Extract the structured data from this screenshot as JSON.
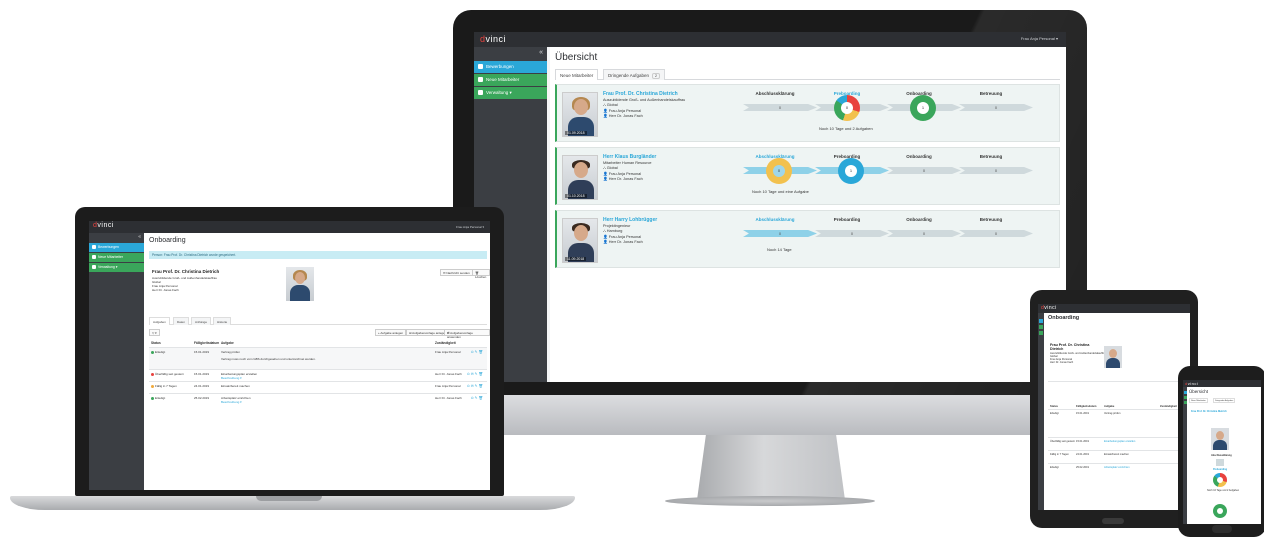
{
  "brand": {
    "prefix": "d",
    "name": "vinci"
  },
  "colors": {
    "accent": "#2aa7d8",
    "green": "#3aa65b",
    "dark": "#2d2f33",
    "red": "#e8423e"
  },
  "desktop": {
    "user": "Frau Anja Personal ▾",
    "collapse": "«",
    "nav": [
      {
        "label": "Bewerbungen",
        "icon": "user-icon"
      },
      {
        "label": "Neue Mitarbeiter",
        "icon": "eye-icon"
      },
      {
        "label": "Verwaltung ▾",
        "icon": "grid-icon"
      }
    ],
    "title": "Übersicht",
    "tabs": [
      {
        "label": "Neue Mitarbeiter"
      },
      {
        "label": "Dringende Aufgaben",
        "count": "2"
      }
    ],
    "phases": [
      "Abschlussklärung",
      "Preboarding",
      "Onboarding",
      "Betreuung"
    ],
    "cards": [
      {
        "name": "Frau Prof. Dr. Christina Dietrich",
        "role": "Auszubildende Groß- und Außenhandelskauffrau",
        "location": "Global",
        "contact1": "Frau Anja Personal",
        "contact2": "Herr Dr. Jonas Fach",
        "date": "01.09.2018",
        "values": [
          "0",
          "0",
          "1",
          "0"
        ],
        "note": "Noch 10 Tage und 2 Aufgaben"
      },
      {
        "name": "Herr Klaus Burgländer",
        "role": "Mitarbeiter Human Resource",
        "location": "Global",
        "contact1": "Frau Anja Personal",
        "contact2": "Herr Dr. Jonas Fach",
        "date": "01.10.2018",
        "values": [
          "0",
          "1",
          "0",
          "0"
        ],
        "note": "Noch 10 Tage und eine Aufgabe"
      },
      {
        "name": "Herr Harry Lohbrügger",
        "role": "Projektingenieur",
        "location": "Hamburg",
        "contact1": "Frau Anja Personal",
        "contact2": "Herr Dr. Jonas Fach",
        "date": "11.09.2018",
        "values": [
          "0",
          "0",
          "0",
          "0"
        ],
        "note": "Noch 14 Tage"
      }
    ]
  },
  "laptop": {
    "user": "Frau Anja Personal ▾",
    "collapse": "«",
    "nav": [
      {
        "label": "Bewerbungen"
      },
      {
        "label": "Neue Mitarbeiter"
      },
      {
        "label": "Verwaltung ▾"
      }
    ],
    "title": "Onboarding",
    "alert": "Person: Frau Prof. Dr. Christina Dietrich wurde gespeichert.",
    "person": {
      "name": "Frau Prof. Dr. Christina Dietrich",
      "role": "Auszubildende Groß- und Außenhandelskauffrau",
      "location": "Global",
      "contact1": "Frau Anja Personal",
      "contact2": "Herr Dr. Jonas Fach"
    },
    "buttons": {
      "message": "✉ Nachricht senden",
      "delete": "🗑 Löschen"
    },
    "tabs": [
      "Aufgaben",
      "Daten",
      "Anhänge",
      "Historie"
    ],
    "tools": [
      "+ Aufgabe anlegen",
      "⊞ Aufgabenvorlage anlegen",
      "⇄ Aufgabenvorlage anwenden"
    ],
    "headers": [
      "Status",
      "Fälligkeitsdatum",
      "Aufgabe",
      "Zuständigkeit"
    ],
    "rows": [
      {
        "status": "Erledigt",
        "date": "15.01.2019",
        "task": "Vertrag prüfen",
        "detail": "Vertrag muss noch vom GBS durchgesehen und unterzeichnet werden.",
        "owner": "Frau Anja Personal",
        "dot": "#3aa65b"
      },
      {
        "status": "Überfällig seit gestern",
        "date": "15.01.2019",
        "task": "Einarbeitungsplan erstellen",
        "detail": "Beschreibung ▾",
        "owner": "Herr Dr. Jonas Fach",
        "dot": "#e8423e"
      },
      {
        "status": "Fällig in 7 Tagen",
        "date": "24.01.2019",
        "task": "Einsatzbereit machen",
        "detail": "",
        "owner": "Frau Anja Personal",
        "dot": "#f0a93b"
      },
      {
        "status": "Erledigt",
        "date": "25.02.2019",
        "task": "Arbeitsplatz einrichten",
        "detail": "Beschreibung ▾",
        "owner": "Herr Dr. Jonas Fach",
        "dot": "#3aa65b"
      }
    ]
  },
  "tablet": {
    "title": "Onboarding",
    "person": {
      "name": "Frau Prof. Dr. Christina Dietrich",
      "role": "Auszubildende Groß- und Außenhandelskauffrau",
      "location": "Global",
      "contact1": "Frau Anja Personal",
      "contact2": "Herr Dr. Jonas Fach"
    },
    "headers": [
      "Status",
      "Fälligkeitsdatum",
      "Aufgabe",
      "Zuständigkeit"
    ],
    "rows": [
      {
        "status": "Erledigt",
        "date": "15.01.2019",
        "task": "Vertrag prüfen"
      },
      {
        "status": "Überfällig seit gestern",
        "date": "15.01.2019",
        "task": "Einarbeitungsplan erstellen"
      },
      {
        "status": "Fällig in 7 Tagen",
        "date": "24.01.2019",
        "task": "Einsatzbereit machen"
      },
      {
        "status": "Erledigt",
        "date": "25.02.2019",
        "task": "Arbeitsplatz einrichten"
      }
    ]
  },
  "phone": {
    "title": "Übersicht",
    "tabs": [
      "Neue Mitarbeiter",
      "Dringende Aufgaben"
    ],
    "name": "Frau Prof. Dr. Christina Dietrich",
    "phase1": "Abschlussklärung",
    "phase2": "Preboarding",
    "note": "Noch 10 Tage und 2 Aufgaben"
  }
}
